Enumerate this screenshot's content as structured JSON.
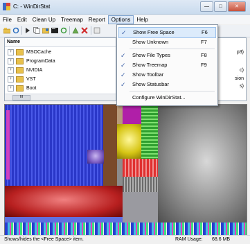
{
  "window": {
    "title": "C: - WinDirStat"
  },
  "menubar": {
    "items": [
      "File",
      "Edit",
      "Clean Up",
      "Treemap",
      "Report",
      "Options",
      "Help"
    ]
  },
  "tree": {
    "column_header": "Name",
    "rows": [
      "MSOCache",
      "ProgramData",
      "NVIDIA",
      "VST",
      "Boot"
    ],
    "right_fragments": [
      "p3)",
      "c)",
      "sion",
      "s)"
    ],
    "scroll_label": "III"
  },
  "options_menu": {
    "items": [
      {
        "checked": true,
        "label": "Show Free Space",
        "shortcut": "F6",
        "highlighted": true
      },
      {
        "checked": false,
        "label": "Show Unknown",
        "shortcut": "F7"
      },
      {
        "checked": true,
        "label": "Show File Types",
        "shortcut": "F8"
      },
      {
        "checked": true,
        "label": "Show Treemap",
        "shortcut": "F9"
      },
      {
        "checked": true,
        "label": "Show Toolbar",
        "shortcut": ""
      },
      {
        "checked": true,
        "label": "Show Statusbar",
        "shortcut": ""
      },
      {
        "checked": false,
        "label": "Configure WinDirStat...",
        "shortcut": ""
      }
    ]
  },
  "statusbar": {
    "message": "Shows/hides the <Free Space> item.",
    "ram_label": "RAM Usage:",
    "ram_value": "68.6 MB"
  },
  "icons": [
    "windirstat-app-icon",
    "open-icon",
    "refresh-icon",
    "play-icon",
    "copy-icon",
    "explorer-icon",
    "cmd-icon",
    "refresh-selected-icon",
    "cleanup-icon",
    "delete-icon"
  ],
  "colors": {
    "menu_highlight": "#dcebfb",
    "check": "#3a5fa8",
    "folder": "#e8c14c"
  }
}
